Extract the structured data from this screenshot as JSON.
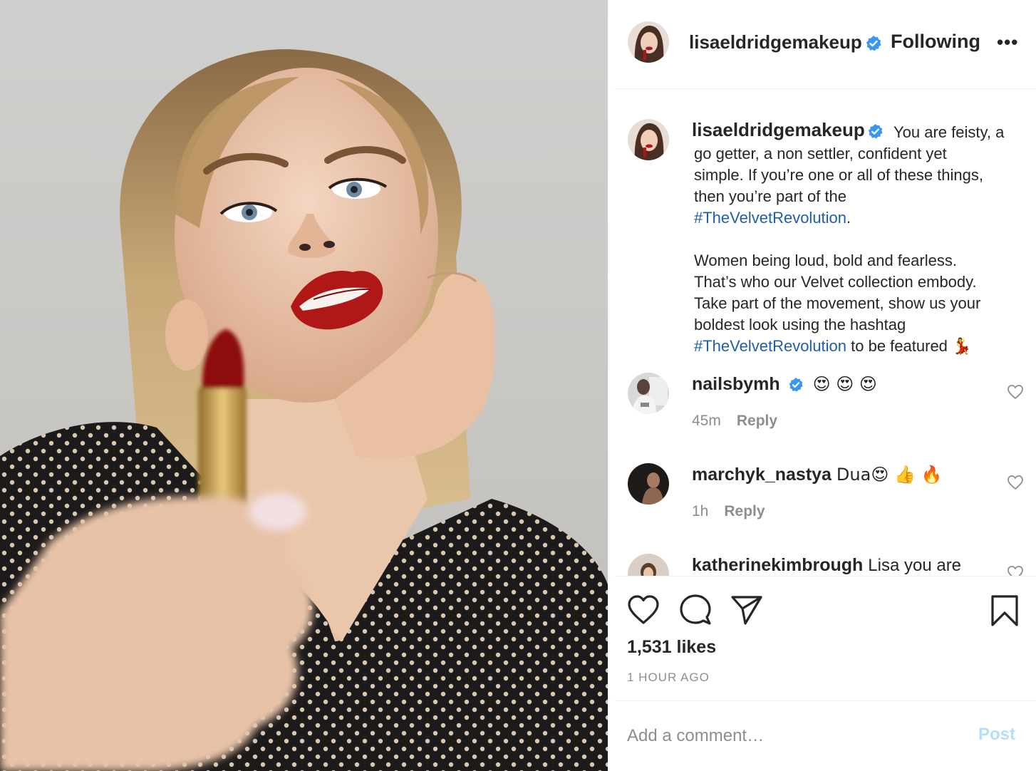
{
  "header": {
    "username": "lisaeldridgemakeup",
    "follow_label": "Following",
    "more_label": "•••"
  },
  "caption": {
    "username": "lisaeldridgemakeup",
    "first_line": "You are feisty, a",
    "line2": "go getter, a non settler, confident yet",
    "line3": "simple. If you’re one or all of these things,",
    "line4": "then you’re part of the",
    "hashtag1": "#TheVelvetRevolution",
    "period": ".",
    "p2_line1": "Women being loud, bold and fearless.",
    "p2_line2": "That’s who our Velvet collection embody.",
    "p2_line3": "Take part of the movement, show us your",
    "p2_line4": "boldest look using the hashtag",
    "hashtag2": "#TheVelvetRevolution",
    "tail": " to be featured",
    "tail_emoji": "💃"
  },
  "comments": [
    {
      "username": "nailsbymh",
      "text": "😍 😍 😍",
      "time": "45m",
      "reply_label": "Reply"
    },
    {
      "username": "marchyk_nastya",
      "text": "Dua😍 👍 🔥",
      "time": "1h",
      "reply_label": "Reply"
    },
    {
      "username": "katherinekimbrough",
      "text": "Lisa you are"
    }
  ],
  "likes": "1,531 likes",
  "time_ago": "1 HOUR AGO",
  "add_comment": {
    "placeholder": "Add a comment…",
    "post_label": "Post"
  },
  "colors": {
    "hashtag": "#1f5ea8",
    "verified": "#3897f0",
    "post_disabled": "#b2dffc"
  },
  "icons": [
    "heart-icon",
    "comment-icon",
    "share-icon",
    "bookmark-icon",
    "verified-badge-icon",
    "more-icon"
  ]
}
